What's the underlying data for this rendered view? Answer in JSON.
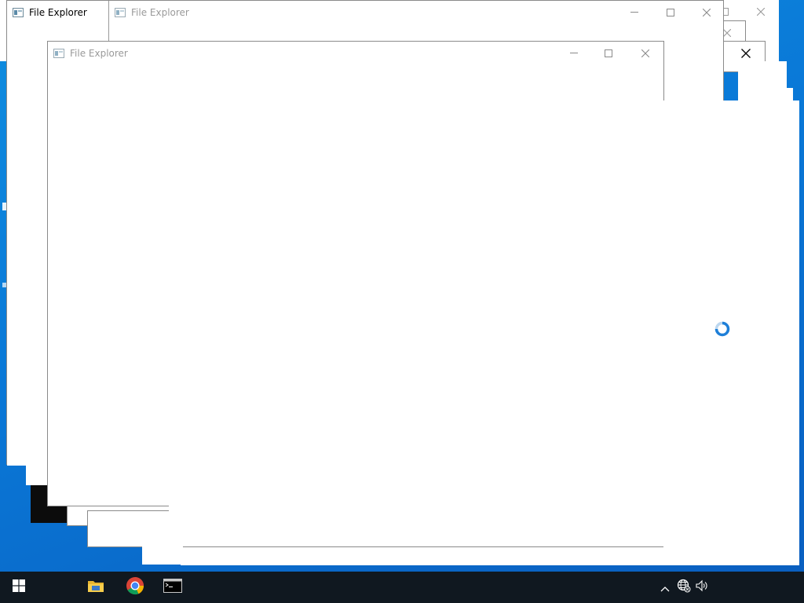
{
  "windows": [
    {
      "title": "File Explorer",
      "state": "active"
    },
    {
      "title": "File Explorer",
      "state": "inactive"
    },
    {
      "title": "File Explorer",
      "state": "inactive"
    }
  ],
  "controls": {
    "minimize_icon": "minimize-icon",
    "maximize_icon": "maximize-icon",
    "close_icon": "close-icon"
  },
  "taskbar": {
    "start_icon": "windows-logo-icon",
    "pinned": [
      {
        "name": "file-explorer",
        "icon": "folder-icon"
      },
      {
        "name": "chrome",
        "icon": "chrome-icon"
      },
      {
        "name": "command-prompt",
        "icon": "terminal-icon"
      }
    ],
    "tray": [
      {
        "name": "show-hidden-icons",
        "icon": "chevron-up-icon"
      },
      {
        "name": "network",
        "icon": "globe-icon"
      },
      {
        "name": "volume",
        "icon": "speaker-icon"
      }
    ]
  },
  "cursor": {
    "state": "busy",
    "icon": "loading-spinner-icon"
  },
  "colors": {
    "desktop": "#0a78d7",
    "taskbar": "#101820",
    "window": "#ffffff",
    "border": "#8a8a8a",
    "spinner": "#1e7fd8"
  }
}
